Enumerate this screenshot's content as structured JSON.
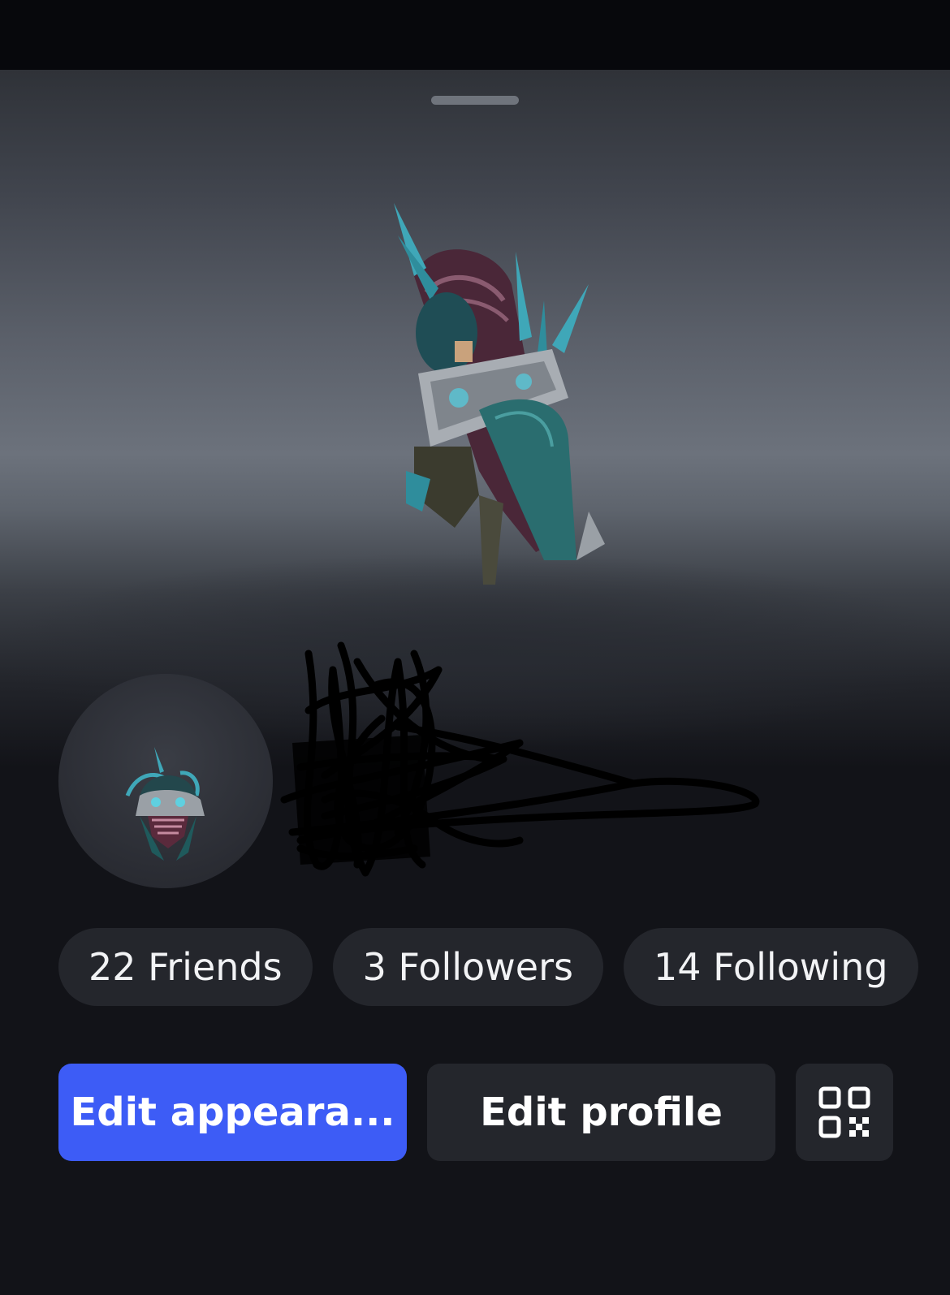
{
  "profile": {
    "stats": {
      "friends": "22 Friends",
      "followers": "3 Followers",
      "following": "14 Following"
    },
    "actions": {
      "edit_appearance": "Edit appeara...",
      "edit_profile": "Edit profile",
      "qr_icon": "qr-code-icon"
    },
    "colors": {
      "primary_button": "#3d5cf6",
      "pill_background": "#24262c",
      "page_background": "#121318"
    }
  }
}
